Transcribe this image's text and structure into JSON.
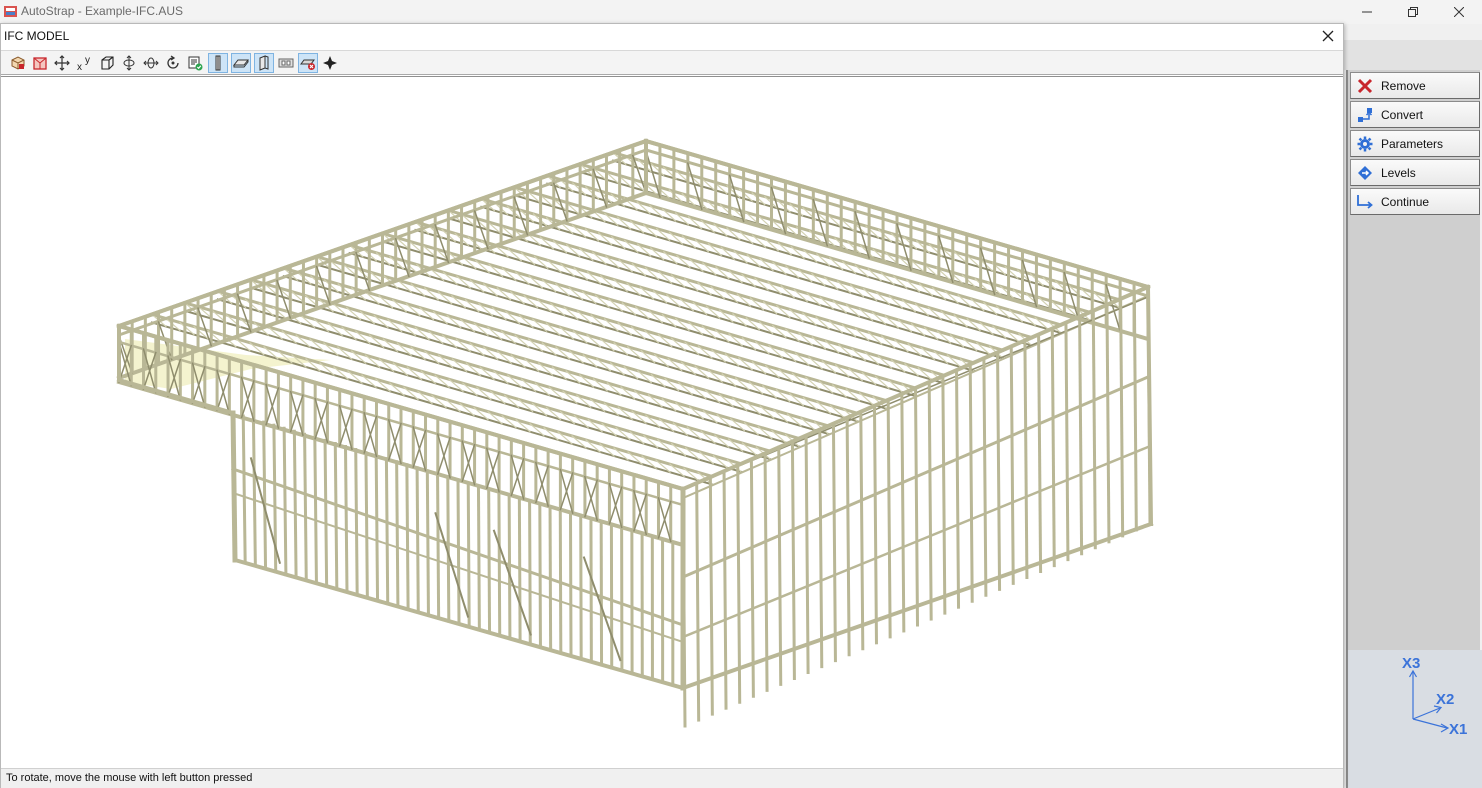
{
  "app": {
    "title": "AutoStrap - Example-IFC.AUS"
  },
  "dialog": {
    "title": "IFC MODEL",
    "status": "To rotate, move the mouse with left button pressed",
    "toolbar": [
      {
        "icon": "iso-view-icon",
        "active": false
      },
      {
        "icon": "box-red-icon",
        "active": false
      },
      {
        "icon": "pan-arrows-icon",
        "active": false
      },
      {
        "icon": "xy-axes-icon",
        "active": false
      },
      {
        "icon": "cube-wire-icon",
        "active": false
      },
      {
        "icon": "rotate-vertical-icon",
        "active": false
      },
      {
        "icon": "rotate-horizontal-icon",
        "active": false
      },
      {
        "icon": "reset-rotation-icon",
        "active": false
      },
      {
        "icon": "layer-check-icon",
        "active": false
      },
      {
        "icon": "column-icon",
        "active": true
      },
      {
        "icon": "slab-icon",
        "active": true
      },
      {
        "icon": "wall-panel-icon",
        "active": true
      },
      {
        "icon": "opening-icon",
        "active": false
      },
      {
        "icon": "hide-element-icon",
        "active": true
      },
      {
        "icon": "pointer-icon",
        "active": false
      }
    ]
  },
  "side_panel": {
    "buttons": [
      {
        "label": "Remove",
        "icon": "remove-x-icon"
      },
      {
        "label": "Convert",
        "icon": "convert-icon"
      },
      {
        "label": "Parameters",
        "icon": "gear-icon"
      },
      {
        "label": "Levels",
        "icon": "levels-icon"
      },
      {
        "label": "Continue",
        "icon": "continue-arrow-icon"
      }
    ]
  },
  "axes": {
    "x3": "X3",
    "x2": "X2",
    "x1": "X1",
    "color": "#3b73d9"
  },
  "model": {
    "frame_color": "#b9b796",
    "sheet_color": "#f4f3cf"
  }
}
